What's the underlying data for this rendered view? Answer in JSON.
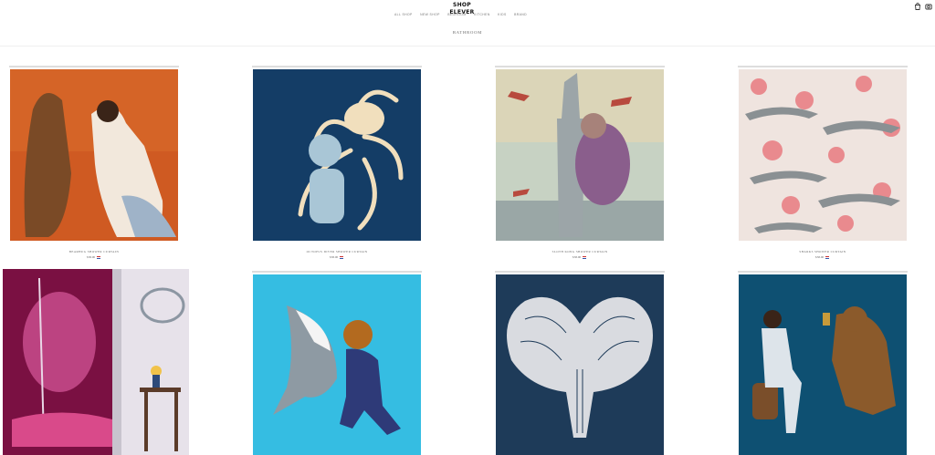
{
  "header": {
    "logo": "SHOP ELEVER",
    "nav": [
      "All Shop",
      "New Shop",
      "Bedroom",
      "Kitchen",
      "Kids",
      "Brand"
    ],
    "cart_icon": "bag-icon",
    "account_icon": "camera-icon"
  },
  "page": {
    "title": "Bathroom"
  },
  "products": [
    {
      "title": "Bearhug Shower Curtain",
      "price": "$58.00",
      "art": "bear-man-punch",
      "bg": "#c9501f"
    },
    {
      "title": "Octopus Diver Shower Curtain",
      "price": "$58.00",
      "art": "octopus-diver",
      "bg": "#123a63"
    },
    {
      "title": "Sloth Kong Shower Curtain",
      "price": "$58.00",
      "art": "sloth-tower-planes",
      "bg": "#b9c8ba"
    },
    {
      "title": "Sharks Shower Curtain",
      "price": "$58.00",
      "art": "sharks-roses",
      "bg": "#e8dcd6"
    },
    {
      "title": "",
      "price": "",
      "art": "sloth-pole-room",
      "bg": "#7a1042"
    },
    {
      "title": "",
      "price": "",
      "art": "shark-diver-fight",
      "bg": "#2fb8de"
    },
    {
      "title": "",
      "price": "",
      "art": "elephants-heart",
      "bg": "#1d3a58"
    },
    {
      "title": "",
      "price": "",
      "art": "man-bear-cheers",
      "bg": "#0e4f70"
    }
  ]
}
